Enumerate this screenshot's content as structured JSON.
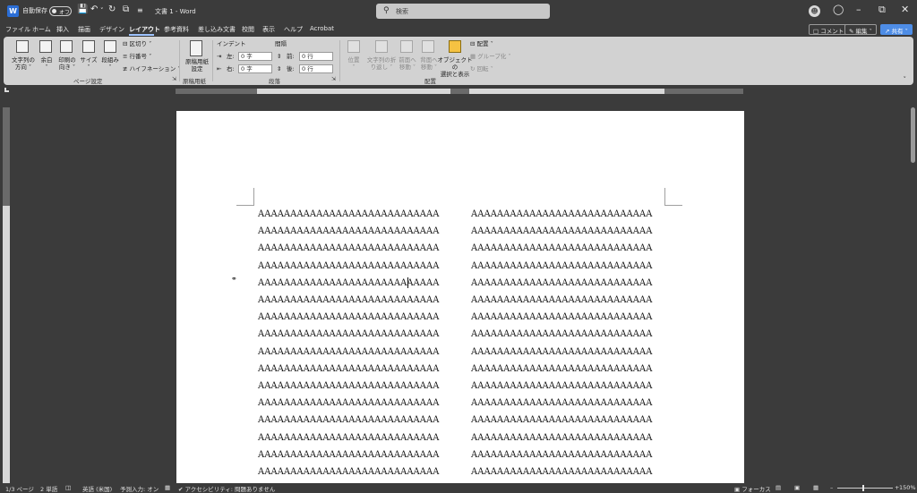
{
  "titlebar": {
    "autosave_label": "自動保存",
    "autosave_state": "オフ",
    "doc_title": "文書 1  -  Word",
    "search_placeholder": "検索"
  },
  "menu": {
    "items": [
      "ファイル",
      "ホーム",
      "挿入",
      "描画",
      "デザイン",
      "レイアウト",
      "参考資料",
      "差し込み文書",
      "校閲",
      "表示",
      "ヘルプ",
      "Acrobat"
    ],
    "active": "レイアウト",
    "comment_label": "コメント",
    "edit_label": "編集",
    "share_label": "共有"
  },
  "ribbon": {
    "page_setup": {
      "text_direction": [
        "文字列の",
        "方向"
      ],
      "margins": "余白",
      "orientation": [
        "印刷の",
        "向き"
      ],
      "size": "サイズ",
      "columns": "段組み",
      "breaks": "区切り",
      "line_numbers": "行番号",
      "hyphenation": "ハイフネーション",
      "group_label": "ページ設定"
    },
    "genko": {
      "btn": [
        "原稿用紙",
        "設定"
      ],
      "group_label": "原稿用紙"
    },
    "paragraph": {
      "indent_label": "インデント",
      "spacing_label": "間隔",
      "left_label": "左:",
      "right_label": "右:",
      "before_label": "前:",
      "after_label": "後:",
      "left_value": "0 字",
      "right_value": "0 字",
      "before_value": "0 行",
      "after_value": "0 行",
      "group_label": "段落"
    },
    "arrange": {
      "position": "位置",
      "wrap": [
        "文字列の折",
        "り返し"
      ],
      "forward": [
        "前面へ",
        "移動"
      ],
      "backward": [
        "背面へ",
        "移動"
      ],
      "selection_pane": [
        "オブジェクトの",
        "選択と表示"
      ],
      "align": "配置",
      "group": "グループ化",
      "rotate": "回転",
      "group_label": "配置"
    }
  },
  "document": {
    "line_text": "AAAAAAAAAAAAAAAAAAAAAAAAAAAA",
    "rows_per_column": 16
  },
  "status": {
    "page": "1/3 ページ",
    "words": "2 単語",
    "language": "英語 (米国)",
    "predictive": "予測入力: オン",
    "accessibility": "アクセシビリティ: 問題ありません",
    "focus": "フォーカス",
    "zoom": "150%"
  }
}
